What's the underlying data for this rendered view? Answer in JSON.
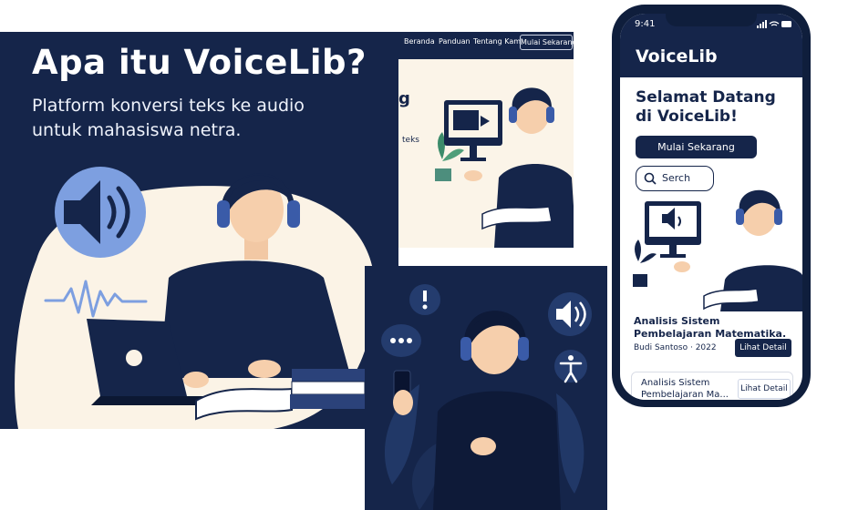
{
  "panel_a": {
    "title": "Apa itu VoiceLib?",
    "subtitle": "Platform konversi teks ke audio untuk mahasiswa netra."
  },
  "panel_b": {
    "nav": {
      "home": "Beranda",
      "guide": "Panduan",
      "about": "Tentang Kami",
      "start": "Mulai Sekarang"
    },
    "headline_fragment": "g",
    "text_fragment": "teks"
  },
  "phone": {
    "time": "9:41",
    "app_title": "VoiceLib",
    "welcome": "Selamat Datang di VoiceLib!",
    "start_button": "Mulai Sekarang",
    "search_placeholder": "Serch",
    "cards": [
      {
        "title": "Analisis Sistem Pembelajaran Matematika.",
        "meta": "Budi Santoso · 2022",
        "button": "Lihat Detail"
      },
      {
        "title": "Analisis Sistem Pembelajaran Ma...",
        "button": "Lihat Detail"
      }
    ]
  },
  "colors": {
    "navy": "#15254a",
    "cream": "#fbf4e8",
    "accent_blue": "#7d9fe0"
  },
  "icons": [
    "speaker-icon",
    "sound-wave-icon",
    "alert-bubble-icon",
    "chat-dots-icon",
    "accessibility-icon",
    "search-icon",
    "wifi-icon",
    "battery-icon",
    "signal-icon"
  ]
}
